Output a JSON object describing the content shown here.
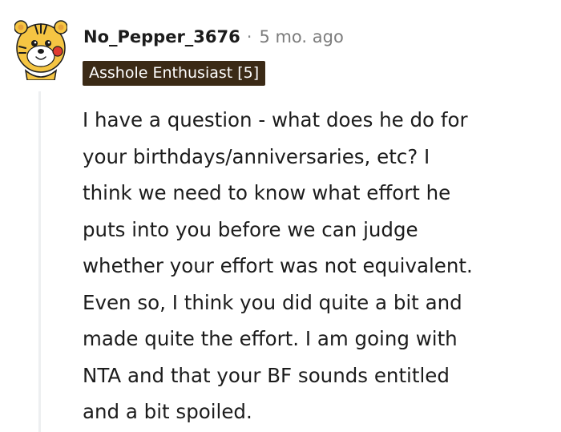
{
  "comment": {
    "username": "No_Pepper_3676",
    "separator": "·",
    "timestamp": "5 mo. ago",
    "flair": "Asshole Enthusiast [5]",
    "avatar_icon": "snoo-tiger-avatar-icon",
    "body": "I have a question - what does he do for\nyour birthdays/anniversaries, etc? I\nthink we need to know what effort he\nputs into you before we can judge\nwhether your effort was not equivalent.\nEven so, I think you did quite a bit and\nmade quite the effort. I am going with\nNTA and that your BF sounds entitled\nand a bit spoiled."
  },
  "colors": {
    "flair_background": "#3b2a16",
    "flair_text": "#ffffff",
    "thread_line": "#edeff1",
    "timestamp": "#7c7c7c"
  }
}
